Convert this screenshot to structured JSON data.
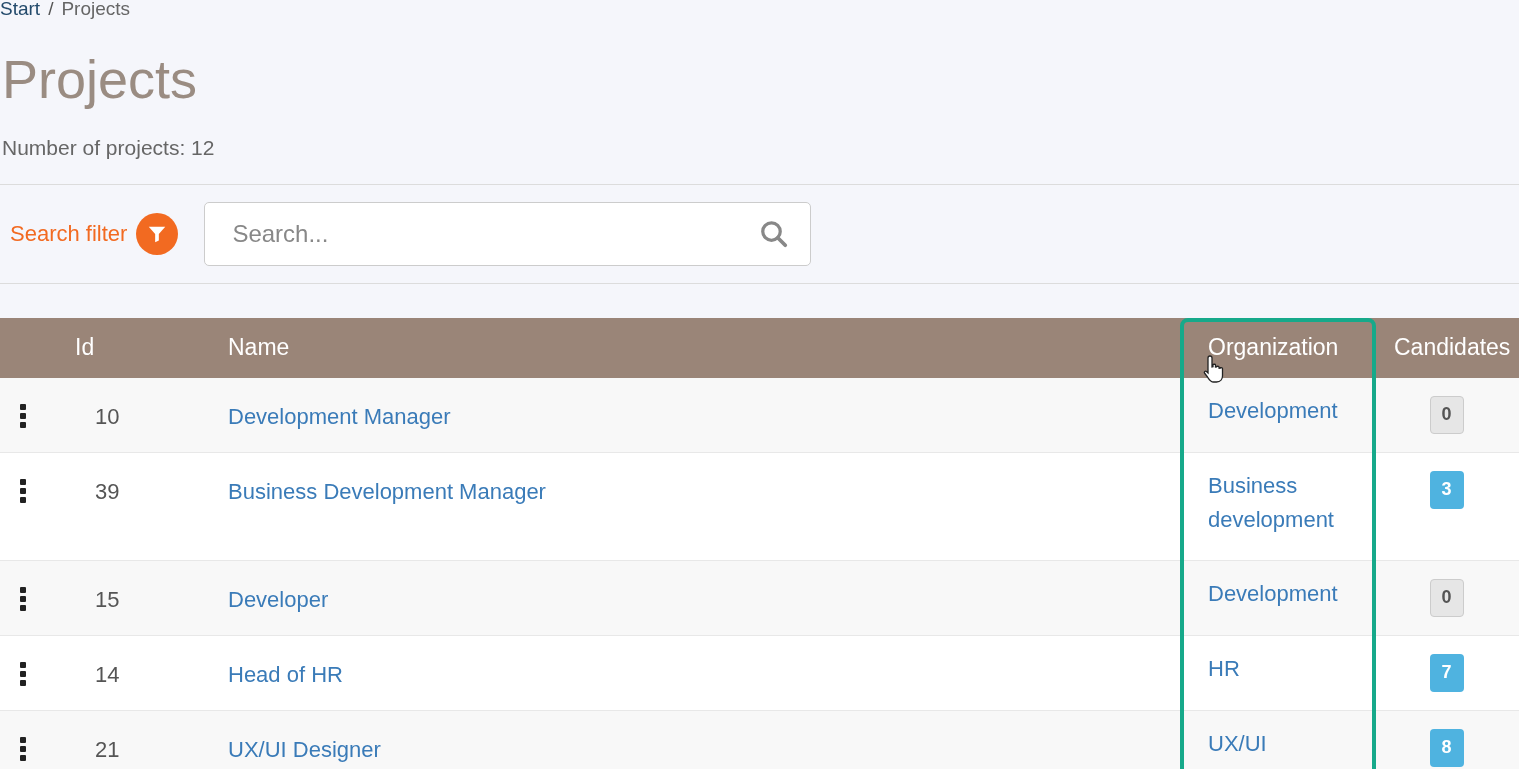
{
  "breadcrumb": [
    {
      "label": "Start",
      "current": false
    },
    {
      "label": "/",
      "kind": "separator"
    },
    {
      "label": "Projects",
      "current": true
    }
  ],
  "title": "Projects",
  "count_text": "Number of projects: 12",
  "filter": {
    "label": "Search filter"
  },
  "search": {
    "placeholder": "Search..."
  },
  "table": {
    "columns": [
      {},
      {
        "label": "Id"
      },
      {
        "label": "Name"
      },
      {
        "label": "Organization",
        "highlighted": true
      },
      {
        "label": "Candidates",
        "highlighted": false
      }
    ],
    "rows": [
      {
        "id": "10",
        "name": "Development Manager",
        "organization": "Development",
        "candidates": "0",
        "kind": "empty"
      },
      {
        "id": "39",
        "name": "Business Development Manager",
        "organization": "Business development",
        "candidates": "3",
        "kind": "filled"
      },
      {
        "id": "15",
        "name": "Developer",
        "organization": "Development",
        "candidates": "0",
        "kind": "empty"
      },
      {
        "id": "14",
        "name": "Head of HR",
        "organization": "HR",
        "candidates": "7",
        "kind": "filled"
      },
      {
        "id": "21",
        "name": "UX/UI Designer",
        "organization": "UX/UI",
        "candidates": "8",
        "kind": "filled"
      }
    ]
  }
}
